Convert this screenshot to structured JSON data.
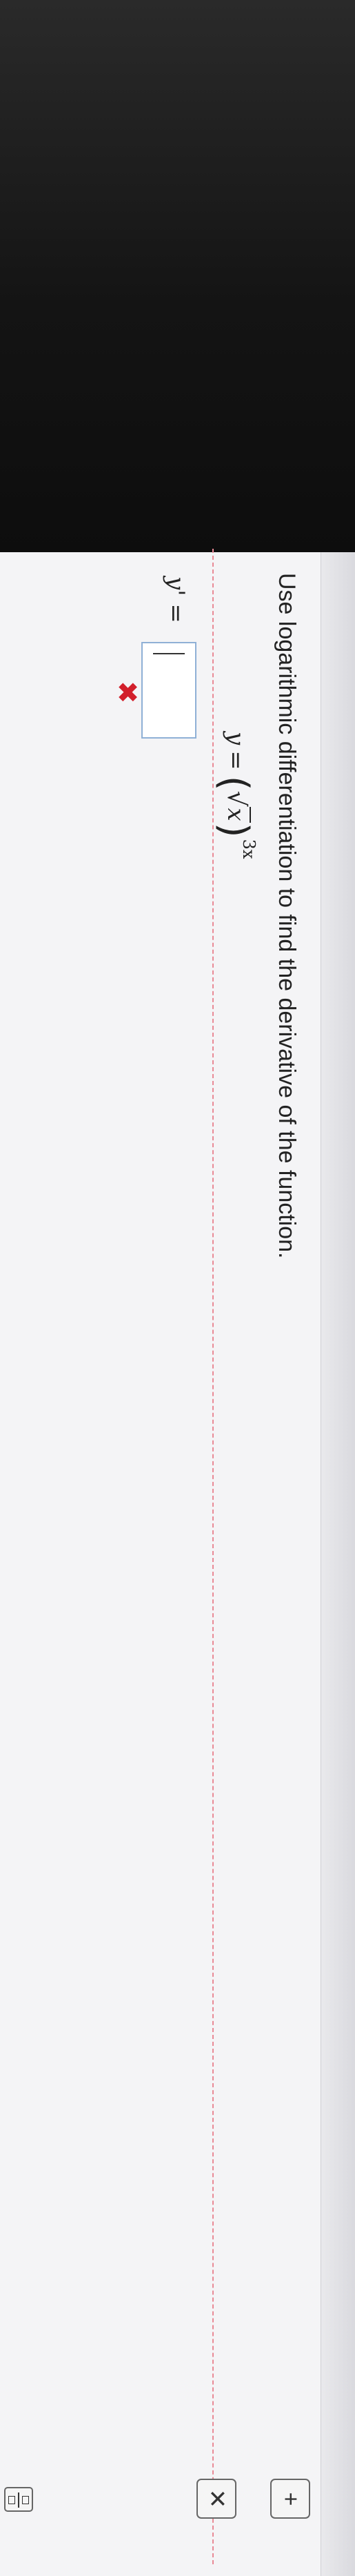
{
  "problem": {
    "instruction": "Use logarithmic differentiation to find the derivative of the function.",
    "equation": {
      "lhs": "y",
      "equals": "=",
      "open_paren": "(",
      "radical": "√",
      "radicand": "x",
      "close_paren": ")",
      "exponent": "3x"
    }
  },
  "answer": {
    "label": "y' =",
    "value": "",
    "status": "incorrect",
    "status_symbol": "✖",
    "status_color": "#d21f2b"
  },
  "toolbar": {
    "clear_symbol": "✕",
    "expand_symbol": "+"
  }
}
